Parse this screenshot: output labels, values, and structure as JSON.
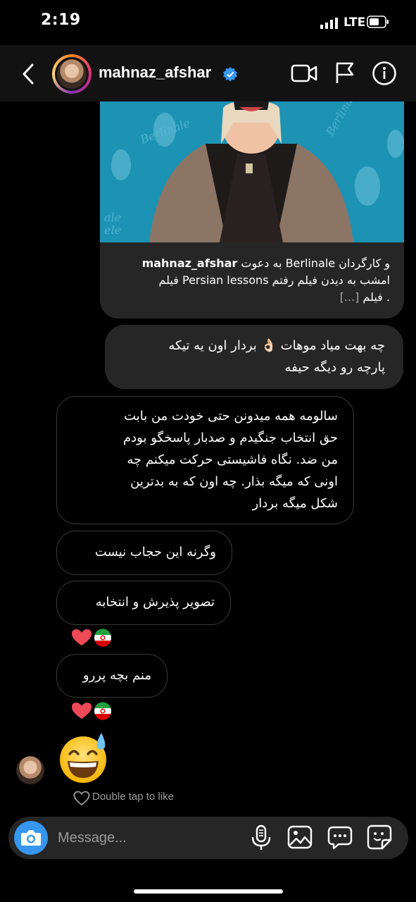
{
  "status_bar": {
    "time": "2:19",
    "network": "LTE"
  },
  "header": {
    "username": "mahnaz_afshar"
  },
  "shared_post": {
    "caption_user": "mahnaz_afshar",
    "caption_line1": "و کارگردان Berlinale به دعوت",
    "caption_line2": "امشب به دیدن فیلم رفتم Persian lessons فیلم",
    "caption_line3": ". فیلم",
    "caption_more": "[...]"
  },
  "messages": [
    {
      "direction": "sent",
      "lines": [
        "چه بهت میاد موهات 👌🏻 بردار اون یه تیکه",
        "پارچه رو دیگه حیفه"
      ]
    },
    {
      "direction": "received",
      "lines": [
        "سالومه همه میدونن حتی خودت من بابت",
        "حق انتخاب جنگیدم و صدبار پاسخگو بودم",
        "من ضد. نگاه فاشیستی حرکت میکنم چه",
        "اونی که میگه بذار. چه اون که به بدترین",
        "شکل میگه بردار"
      ]
    },
    {
      "direction": "received",
      "lines": [
        "وگرنه این حجاب نیست"
      ]
    },
    {
      "direction": "received",
      "lines": [
        "تصویر پذیرش و انتخابه"
      ]
    },
    {
      "direction": "received",
      "lines": [
        "منم بچه پررو"
      ]
    }
  ],
  "reactions": [
    "❤️",
    "🇮🇷"
  ],
  "last_emoji": "😅",
  "like_hint": "Double tap to like",
  "composer": {
    "placeholder": "Message..."
  },
  "colors": {
    "accent": "#3797f0",
    "verified": "#3897f0",
    "bubble_sent": "#262626",
    "background": "#000000"
  },
  "icons": [
    "back-icon",
    "verified-icon",
    "video-icon",
    "flag-icon",
    "info-icon",
    "camera-icon",
    "mic-icon",
    "gallery-icon",
    "chat-icon",
    "sticker-icon",
    "heart-outline-icon"
  ]
}
